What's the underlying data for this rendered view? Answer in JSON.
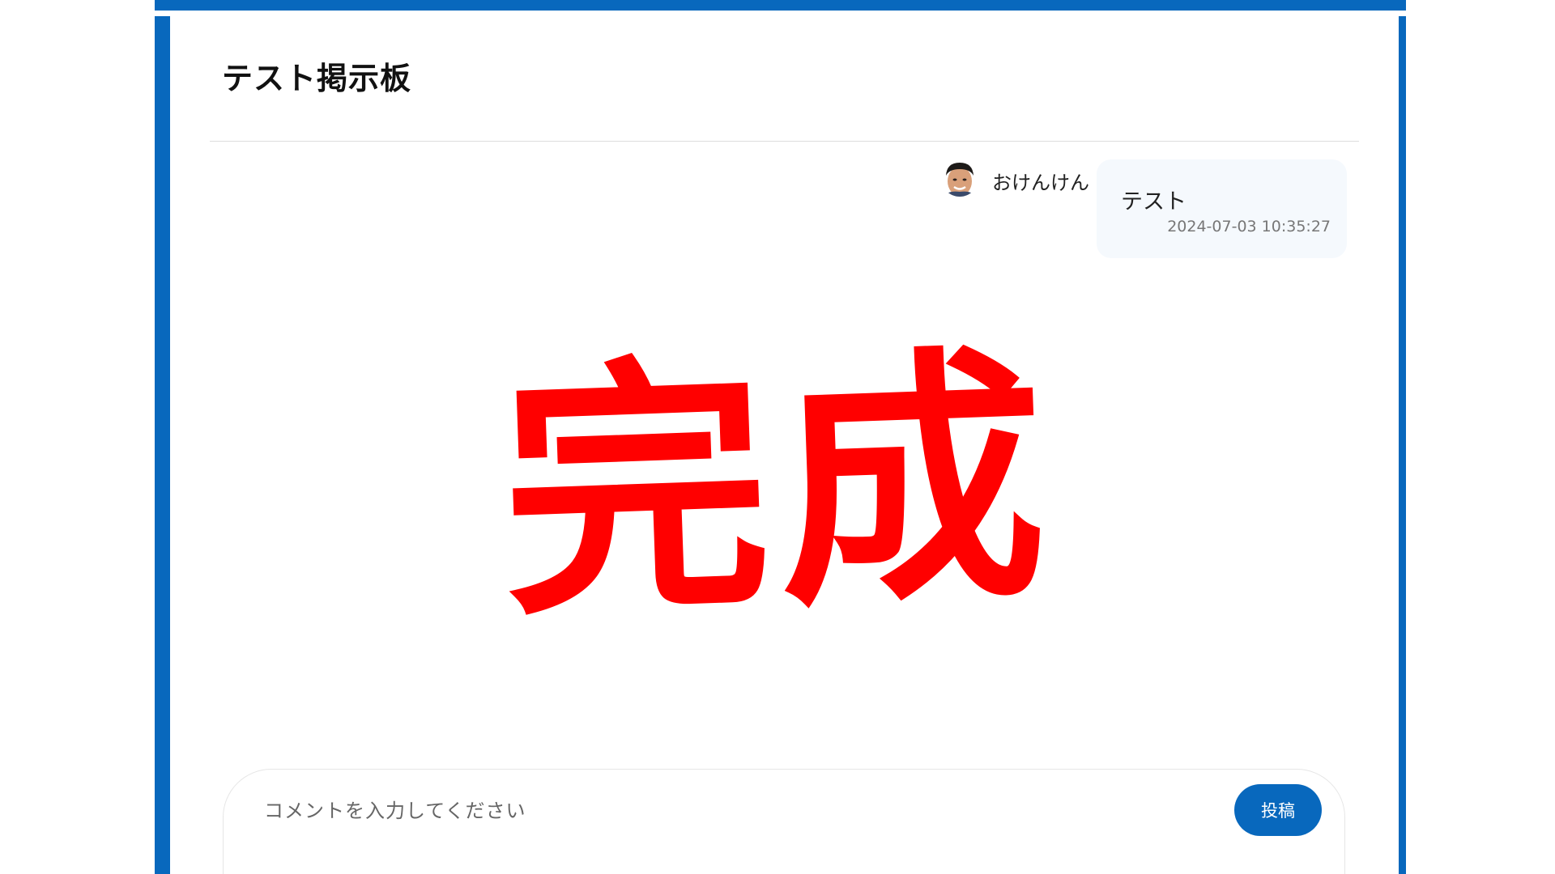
{
  "board": {
    "title": "テスト掲示板"
  },
  "messages": [
    {
      "author": "おけんけん",
      "text": "テスト",
      "timestamp": "2024-07-03 10:35:27"
    }
  ],
  "stamp": {
    "text": "完成",
    "color": "#ff0000"
  },
  "composer": {
    "placeholder": "コメントを入力してください",
    "value": "",
    "post_label": "投稿"
  },
  "colors": {
    "accent": "#0868bd",
    "bubble": "#f5f9fd"
  }
}
